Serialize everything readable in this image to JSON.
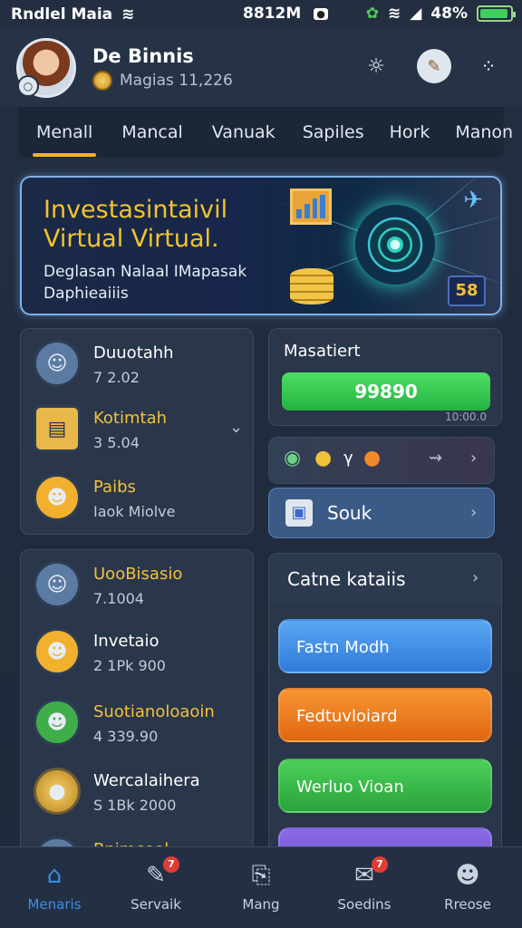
{
  "status": {
    "carrier": "Rndlel Maia",
    "time": "8812M",
    "battery": "48%"
  },
  "header": {
    "name": "De Binnis",
    "coins_label": "Magias 11,226"
  },
  "tabs": [
    "Menall",
    "Mancal",
    "Vanuak",
    "Sapiles",
    "Hork",
    "Manon"
  ],
  "hero": {
    "title": "Investasintaivil Virtual Virtual.",
    "subtitle": "Deglasan Nalaal IMapasak Daphieaiiis",
    "badge": "58"
  },
  "list1": [
    {
      "title": "Duuotahh",
      "value": "7 2.02"
    },
    {
      "title": "Kotimtah",
      "value": "3 5.04"
    },
    {
      "title": "Paibs",
      "value": "Iaok Miolve"
    }
  ],
  "market": {
    "title": "Masatiert",
    "value": "99890",
    "footer": "10:00.0"
  },
  "souk": {
    "label": "Souk"
  },
  "list2": [
    {
      "title": "UooBisasio",
      "value": "7.1004"
    },
    {
      "title": "Invetaio",
      "value": "2 1Pk 900"
    },
    {
      "title": "Suotianoloaoin",
      "value": "4 339.90"
    },
    {
      "title": "Wercalaihera",
      "value": "S 1Bk 2000"
    },
    {
      "title": "Bnimcool",
      "value": ""
    }
  ],
  "category": {
    "title": "Catne kataiis"
  },
  "actions": [
    {
      "label": "Fastn Modh",
      "color": "#3f8ee9"
    },
    {
      "label": "Fedtuvloiard",
      "color": "#f07a1a"
    },
    {
      "label": "Werluo Vioan",
      "color": "#36b548"
    },
    {
      "label": "",
      "color": "#7a5ad8"
    }
  ],
  "nav": [
    {
      "label": "Menaris",
      "icon": "home-icon",
      "badge": ""
    },
    {
      "label": "Servaik",
      "icon": "edit-icon",
      "badge": "7"
    },
    {
      "label": "Mang",
      "icon": "clipboard-icon",
      "badge": ""
    },
    {
      "label": "Soedins",
      "icon": "wallet-icon",
      "badge": "7"
    },
    {
      "label": "Rreose",
      "icon": "profile-icon",
      "badge": ""
    }
  ]
}
